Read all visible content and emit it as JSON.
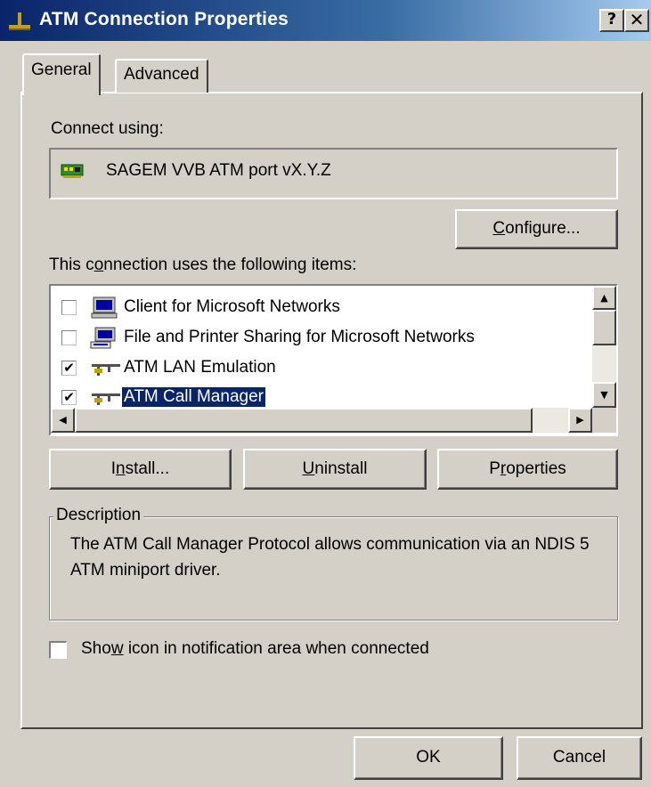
{
  "window": {
    "title": "ATM Connection Properties",
    "help_glyph": "?",
    "close_glyph": "✕"
  },
  "tabs": [
    {
      "label": "General",
      "active": true
    },
    {
      "label": "Advanced",
      "active": false
    }
  ],
  "connect_using": {
    "label": "Connect using:",
    "adapter": "SAGEM VVB ATM port vX.Y.Z",
    "adapter_icon": "network-card-icon"
  },
  "configure_button": {
    "pre": "",
    "accel": "C",
    "post": "onfigure..."
  },
  "items_label": {
    "pre": "This c",
    "accel": "o",
    "post": "nnection uses the following items:"
  },
  "items": [
    {
      "label": "Client for Microsoft Networks",
      "checked": false,
      "icon": "client-computer-icon",
      "selected": false
    },
    {
      "label": "File and Printer Sharing for Microsoft Networks",
      "checked": false,
      "icon": "file-printer-sharing-icon",
      "selected": false
    },
    {
      "label": "ATM LAN Emulation",
      "checked": true,
      "icon": "protocol-icon",
      "selected": false
    },
    {
      "label": "ATM Call Manager",
      "checked": true,
      "icon": "protocol-icon",
      "selected": true
    }
  ],
  "check_glyph": "✔",
  "action_buttons": {
    "install": {
      "pre": "I",
      "accel": "n",
      "post": "stall..."
    },
    "uninstall": {
      "pre": "",
      "accel": "U",
      "post": "ninstall"
    },
    "properties": {
      "pre": "P",
      "accel": "r",
      "post": "operties"
    }
  },
  "description": {
    "legend": "Description",
    "text": "The ATM Call Manager Protocol allows communication via an NDIS 5 ATM miniport driver."
  },
  "notify_option": {
    "pre": "Sho",
    "accel": "w",
    "post": " icon in notification area when connected",
    "checked": false
  },
  "footer": {
    "ok": "OK",
    "cancel": "Cancel"
  },
  "scroll_glyphs": {
    "up": "▲",
    "down": "▼",
    "left": "◀",
    "right": "▶"
  },
  "colors": {
    "title_bar": "#0a246a",
    "selection": "#0a246a",
    "face": "#d4d0c8"
  }
}
